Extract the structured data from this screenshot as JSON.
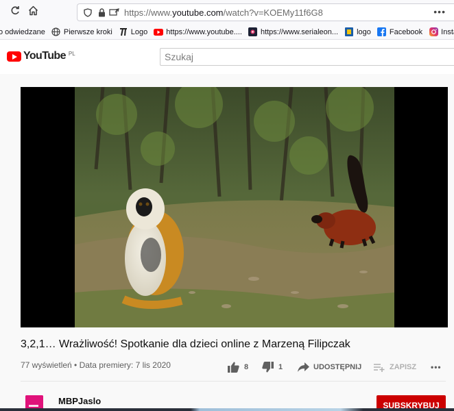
{
  "browser": {
    "url_prefix": "https://www.",
    "url_host": "youtube.com",
    "url_path": "/watch?v=KOEMy11f6G8",
    "more_label": "•••",
    "bookmarks": [
      {
        "label": "o odwiedzane",
        "icon": "none"
      },
      {
        "label": "Pierwsze kroki",
        "icon": "globe-icon"
      },
      {
        "label": "Logo",
        "icon": "logo-t-icon"
      },
      {
        "label": "https://www.youtube....",
        "icon": "youtube-icon"
      },
      {
        "label": "https://www.serialeon...",
        "icon": "site-icon"
      },
      {
        "label": "logo",
        "icon": "logo-square-icon"
      },
      {
        "label": "Facebook",
        "icon": "facebook-icon"
      },
      {
        "label": "Instagram",
        "icon": "instagram-icon"
      }
    ]
  },
  "youtube": {
    "logo_text": "YouTube",
    "region": "PL",
    "search_placeholder": "Szukaj"
  },
  "video": {
    "title": "3,2,1… Wrażliwość! Spotkanie dla dzieci online z Marzeną Filipczak",
    "meta": "77 wyświetleń • Data premiery: 7 lis 2020",
    "likes": "8",
    "dislikes": "1",
    "share_label": "UDOSTĘPNIJ",
    "save_label": "ZAPISZ",
    "more_label": "•••"
  },
  "channel": {
    "name": "MBPJaslo",
    "subscribe_label": "SUBSKRYBUJ"
  },
  "colors": {
    "brand_red": "#ff0000",
    "subscribe_red": "#cc0000",
    "channel_avatar": "#e0127a"
  }
}
